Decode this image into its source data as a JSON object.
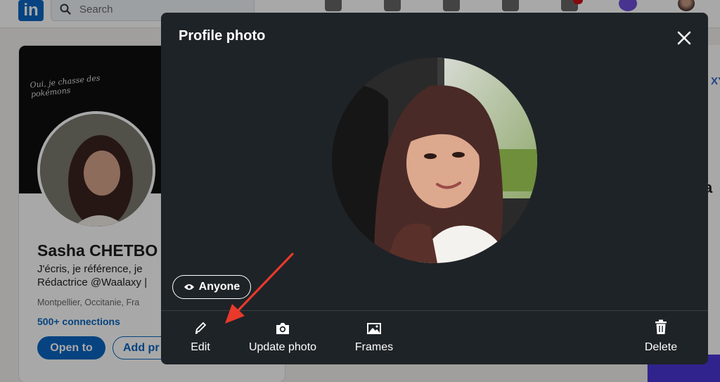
{
  "topbar": {
    "logo": "in",
    "search_placeholder": "Search",
    "nav_icons": [
      "home-icon",
      "my-network-icon",
      "jobs-icon",
      "messaging-icon",
      "notifications-icon"
    ]
  },
  "profile": {
    "cover_text": "Oui, je chasse des pokémons",
    "name": "Sasha CHETBO",
    "headline_line1": "J'écris, je référence, je",
    "headline_line2": "Rédactrice @Waalaxy |",
    "location": "Montpellier, Occitanie, Fra",
    "connections": "500+ connections",
    "open_to_label": "Open to",
    "add_label": "Add pr"
  },
  "right_panel": {
    "partial_word": "XY",
    "partial_letter": "a"
  },
  "modal": {
    "title": "Profile photo",
    "visibility_label": "Anyone",
    "actions": {
      "edit": "Edit",
      "update_photo": "Update photo",
      "frames": "Frames",
      "delete": "Delete"
    }
  },
  "colors": {
    "linkedin_blue": "#0a66c2",
    "modal_bg": "#1e2327",
    "annotation_arrow": "#e8392b"
  }
}
